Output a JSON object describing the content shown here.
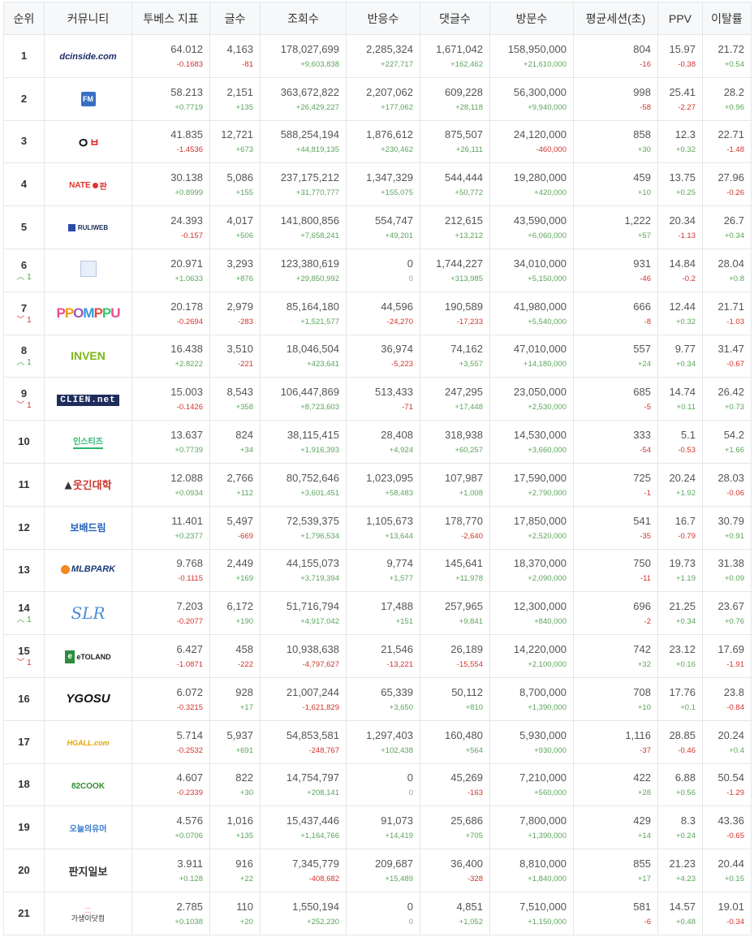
{
  "headers": [
    "순위",
    "커뮤니티",
    "투베스 지표",
    "글수",
    "조회수",
    "반응수",
    "댓글수",
    "방문수",
    "평균세션(초)",
    "PPV",
    "이탈률"
  ],
  "rows": [
    {
      "rank": "1",
      "change": "",
      "dir": "",
      "logo": "dcinside.com",
      "logo_icon": "dcinside-logo-icon",
      "cells": [
        [
          "64.012",
          "-0.1683"
        ],
        [
          "4,163",
          "-81"
        ],
        [
          "178,027,699",
          "+9,603,838"
        ],
        [
          "2,285,324",
          "+227,717"
        ],
        [
          "1,671,042",
          "+162,462"
        ],
        [
          "158,950,000",
          "+21,610,000"
        ],
        [
          "804",
          "-16"
        ],
        [
          "15.97",
          "-0.38"
        ],
        [
          "21.72",
          "+0.54"
        ]
      ]
    },
    {
      "rank": "2",
      "change": "",
      "dir": "",
      "logo": "FM",
      "logo_icon": "fmkorea-logo-icon",
      "cells": [
        [
          "58.213",
          "+0.7719"
        ],
        [
          "2,151",
          "+135"
        ],
        [
          "363,672,822",
          "+26,429,227"
        ],
        [
          "2,207,062",
          "+177,062"
        ],
        [
          "609,228",
          "+28,118"
        ],
        [
          "56,300,000",
          "+9,940,000"
        ],
        [
          "998",
          "-58"
        ],
        [
          "25.41",
          "-2.27"
        ],
        [
          "28.2",
          "+0.96"
        ]
      ]
    },
    {
      "rank": "3",
      "change": "",
      "dir": "",
      "logo": "ㅇㅂ",
      "logo_icon": "ilbe-logo-icon",
      "cells": [
        [
          "41.835",
          "-1.4536"
        ],
        [
          "12,721",
          "+673"
        ],
        [
          "588,254,194",
          "+44,819,135"
        ],
        [
          "1,876,612",
          "+230,462"
        ],
        [
          "875,507",
          "+26,111"
        ],
        [
          "24,120,000",
          "-460,000"
        ],
        [
          "858",
          "+30"
        ],
        [
          "12.3",
          "+0.32"
        ],
        [
          "22.71",
          "-1.48"
        ]
      ]
    },
    {
      "rank": "4",
      "change": "",
      "dir": "",
      "logo": "NATE 판",
      "logo_icon": "nate-pann-logo-icon",
      "cells": [
        [
          "30.138",
          "+0.8999"
        ],
        [
          "5,086",
          "+155"
        ],
        [
          "237,175,212",
          "+31,770,777"
        ],
        [
          "1,347,329",
          "+155,075"
        ],
        [
          "544,444",
          "+50,772"
        ],
        [
          "19,280,000",
          "+420,000"
        ],
        [
          "459",
          "+10"
        ],
        [
          "13.75",
          "+0.25"
        ],
        [
          "27.96",
          "-0.26"
        ]
      ]
    },
    {
      "rank": "5",
      "change": "",
      "dir": "",
      "logo": "RULIWEB",
      "logo_icon": "ruliweb-logo-icon",
      "cells": [
        [
          "24.393",
          "-0.157"
        ],
        [
          "4,017",
          "+506"
        ],
        [
          "141,800,856",
          "+7,658,241"
        ],
        [
          "554,747",
          "+49,201"
        ],
        [
          "212,615",
          "+13,212"
        ],
        [
          "43,590,000",
          "+6,060,000"
        ],
        [
          "1,222",
          "+57"
        ],
        [
          "20.34",
          "-1.13"
        ],
        [
          "26.7",
          "+0.34"
        ]
      ]
    },
    {
      "rank": "6",
      "change": "1",
      "dir": "up",
      "logo": "",
      "logo_icon": "theqoo-logo-icon",
      "cells": [
        [
          "20.971",
          "+1.0633"
        ],
        [
          "3,293",
          "+876"
        ],
        [
          "123,380,619",
          "+29,850,992"
        ],
        [
          "0",
          "0"
        ],
        [
          "1,744,227",
          "+313,985"
        ],
        [
          "34,010,000",
          "+5,150,000"
        ],
        [
          "931",
          "-46"
        ],
        [
          "14.84",
          "-0.2"
        ],
        [
          "28.04",
          "+0.8"
        ]
      ]
    },
    {
      "rank": "7",
      "change": "1",
      "dir": "down",
      "logo": "PPOMPPU",
      "logo_icon": "ppomppu-logo-icon",
      "cells": [
        [
          "20.178",
          "-0.2694"
        ],
        [
          "2,979",
          "-283"
        ],
        [
          "85,164,180",
          "+1,521,577"
        ],
        [
          "44,596",
          "-24,270"
        ],
        [
          "190,589",
          "-17,233"
        ],
        [
          "41,980,000",
          "+5,540,000"
        ],
        [
          "666",
          "-8"
        ],
        [
          "12.44",
          "+0.32"
        ],
        [
          "21.71",
          "-1.03"
        ]
      ]
    },
    {
      "rank": "8",
      "change": "1",
      "dir": "up",
      "logo": "INVEN",
      "logo_icon": "inven-logo-icon",
      "cells": [
        [
          "16.438",
          "+2.8222"
        ],
        [
          "3,510",
          "-221"
        ],
        [
          "18,046,504",
          "+423,641"
        ],
        [
          "36,974",
          "-5,223"
        ],
        [
          "74,162",
          "+3,557"
        ],
        [
          "47,010,000",
          "+14,180,000"
        ],
        [
          "557",
          "+24"
        ],
        [
          "9.77",
          "+0.34"
        ],
        [
          "31.47",
          "-0.67"
        ]
      ]
    },
    {
      "rank": "9",
      "change": "1",
      "dir": "down",
      "logo": "CLIEN.net",
      "logo_icon": "clien-logo-icon",
      "cells": [
        [
          "15.003",
          "-0.1426"
        ],
        [
          "8,543",
          "+358"
        ],
        [
          "106,447,869",
          "+8,723,603"
        ],
        [
          "513,433",
          "-71"
        ],
        [
          "247,295",
          "+17,448"
        ],
        [
          "23,050,000",
          "+2,530,000"
        ],
        [
          "685",
          "-5"
        ],
        [
          "14.74",
          "+0.11"
        ],
        [
          "26.42",
          "+0.73"
        ]
      ]
    },
    {
      "rank": "10",
      "change": "",
      "dir": "",
      "logo": "인스티즈",
      "logo_icon": "instiz-logo-icon",
      "cells": [
        [
          "13.637",
          "+0.7739"
        ],
        [
          "824",
          "+34"
        ],
        [
          "38,115,415",
          "+1,916,393"
        ],
        [
          "28,408",
          "+4,924"
        ],
        [
          "318,938",
          "+60,257"
        ],
        [
          "14,530,000",
          "+3,660,000"
        ],
        [
          "333",
          "-54"
        ],
        [
          "5.1",
          "-0.53"
        ],
        [
          "54.2",
          "+1.66"
        ]
      ]
    },
    {
      "rank": "11",
      "change": "",
      "dir": "",
      "logo": "웃긴대학",
      "logo_icon": "humoruniv-logo-icon",
      "cells": [
        [
          "12.088",
          "+0.0934"
        ],
        [
          "2,766",
          "+112"
        ],
        [
          "80,752,646",
          "+3,601,451"
        ],
        [
          "1,023,095",
          "+58,483"
        ],
        [
          "107,987",
          "+1,008"
        ],
        [
          "17,590,000",
          "+2,790,000"
        ],
        [
          "725",
          "-1"
        ],
        [
          "20.24",
          "+1.92"
        ],
        [
          "28.03",
          "-0.06"
        ]
      ]
    },
    {
      "rank": "12",
      "change": "",
      "dir": "",
      "logo": "보배드림",
      "logo_icon": "bobaedream-logo-icon",
      "cells": [
        [
          "11.401",
          "+0.2377"
        ],
        [
          "5,497",
          "-669"
        ],
        [
          "72,539,375",
          "+1,796,534"
        ],
        [
          "1,105,673",
          "+13,644"
        ],
        [
          "178,770",
          "-2,640"
        ],
        [
          "17,850,000",
          "+2,520,000"
        ],
        [
          "541",
          "-35"
        ],
        [
          "16.7",
          "-0.79"
        ],
        [
          "30.79",
          "+0.91"
        ]
      ]
    },
    {
      "rank": "13",
      "change": "",
      "dir": "",
      "logo": "MLBPARK",
      "logo_icon": "mlbpark-logo-icon",
      "cells": [
        [
          "9.768",
          "-0.1115"
        ],
        [
          "2,449",
          "+169"
        ],
        [
          "44,155,073",
          "+3,719,394"
        ],
        [
          "9,774",
          "+1,577"
        ],
        [
          "145,641",
          "+11,978"
        ],
        [
          "18,370,000",
          "+2,090,000"
        ],
        [
          "750",
          "-11"
        ],
        [
          "19.73",
          "+1.19"
        ],
        [
          "31.38",
          "+0.09"
        ]
      ]
    },
    {
      "rank": "14",
      "change": "1",
      "dir": "up",
      "logo": "SLR",
      "logo_icon": "slr-logo-icon",
      "cells": [
        [
          "7.203",
          "-0.2077"
        ],
        [
          "6,172",
          "+190"
        ],
        [
          "51,716,794",
          "+4,917,042"
        ],
        [
          "17,488",
          "+151"
        ],
        [
          "257,965",
          "+9,841"
        ],
        [
          "12,300,000",
          "+840,000"
        ],
        [
          "696",
          "-2"
        ],
        [
          "21.25",
          "+0.34"
        ],
        [
          "23.67",
          "+0.76"
        ]
      ]
    },
    {
      "rank": "15",
      "change": "1",
      "dir": "down",
      "logo": "eTOLAND",
      "logo_icon": "etoland-logo-icon",
      "cells": [
        [
          "6.427",
          "-1.0871"
        ],
        [
          "458",
          "-222"
        ],
        [
          "10,938,638",
          "-4,797,627"
        ],
        [
          "21,546",
          "-13,221"
        ],
        [
          "26,189",
          "-15,554"
        ],
        [
          "14,220,000",
          "+2,100,000"
        ],
        [
          "742",
          "+32"
        ],
        [
          "23.12",
          "+0.16"
        ],
        [
          "17.69",
          "-1.91"
        ]
      ]
    },
    {
      "rank": "16",
      "change": "",
      "dir": "",
      "logo": "YGOSU",
      "logo_icon": "ygosu-logo-icon",
      "cells": [
        [
          "6.072",
          "-0.3215"
        ],
        [
          "928",
          "+17"
        ],
        [
          "21,007,244",
          "-1,621,829"
        ],
        [
          "65,339",
          "+3,650"
        ],
        [
          "50,112",
          "+810"
        ],
        [
          "8,700,000",
          "+1,390,000"
        ],
        [
          "708",
          "+10"
        ],
        [
          "17.76",
          "+0.1"
        ],
        [
          "23.8",
          "-0.84"
        ]
      ]
    },
    {
      "rank": "17",
      "change": "",
      "dir": "",
      "logo": "HGALL.com",
      "logo_icon": "hgall-logo-icon",
      "cells": [
        [
          "5.714",
          "-0.2532"
        ],
        [
          "5,937",
          "+691"
        ],
        [
          "54,853,581",
          "-248,767"
        ],
        [
          "1,297,403",
          "+102,438"
        ],
        [
          "160,480",
          "+564"
        ],
        [
          "5,930,000",
          "+930,000"
        ],
        [
          "1,116",
          "-37"
        ],
        [
          "28.85",
          "-0.46"
        ],
        [
          "20.24",
          "+0.4"
        ]
      ]
    },
    {
      "rank": "18",
      "change": "",
      "dir": "",
      "logo": "82COOK",
      "logo_icon": "82cook-logo-icon",
      "cells": [
        [
          "4.607",
          "-0.2339"
        ],
        [
          "822",
          "+30"
        ],
        [
          "14,754,797",
          "+208,141"
        ],
        [
          "0",
          "0"
        ],
        [
          "45,269",
          "-163"
        ],
        [
          "7,210,000",
          "+560,000"
        ],
        [
          "422",
          "+28"
        ],
        [
          "6.88",
          "+0.56"
        ],
        [
          "50.54",
          "-1.29"
        ]
      ]
    },
    {
      "rank": "19",
      "change": "",
      "dir": "",
      "logo": "오늘의유머",
      "logo_icon": "todayhumor-logo-icon",
      "cells": [
        [
          "4.576",
          "+0.0706"
        ],
        [
          "1,016",
          "+135"
        ],
        [
          "15,437,446",
          "+1,164,766"
        ],
        [
          "91,073",
          "+14,419"
        ],
        [
          "25,686",
          "+705"
        ],
        [
          "7,800,000",
          "+1,390,000"
        ],
        [
          "429",
          "+14"
        ],
        [
          "8.3",
          "+0.24"
        ],
        [
          "43.36",
          "-0.65"
        ]
      ]
    },
    {
      "rank": "20",
      "change": "",
      "dir": "",
      "logo": "판지일보",
      "logo_icon": "pannzi-logo-icon",
      "cells": [
        [
          "3.911",
          "+0.128"
        ],
        [
          "916",
          "+22"
        ],
        [
          "7,345,779",
          "-408,682"
        ],
        [
          "209,687",
          "+15,489"
        ],
        [
          "36,400",
          "-328"
        ],
        [
          "8,810,000",
          "+1,840,000"
        ],
        [
          "855",
          "+17"
        ],
        [
          "21.23",
          "+4.23"
        ],
        [
          "20.44",
          "+0.15"
        ]
      ]
    },
    {
      "rank": "21",
      "change": "",
      "dir": "",
      "logo": "가생이닷컴",
      "logo_icon": "gasengi-logo-icon",
      "cells": [
        [
          "2.785",
          "+0.1038"
        ],
        [
          "110",
          "+20"
        ],
        [
          "1,550,194",
          "+252,230"
        ],
        [
          "0",
          "0"
        ],
        [
          "4,851",
          "+1,052"
        ],
        [
          "7,510,000",
          "+1,150,000"
        ],
        [
          "581",
          "-6"
        ],
        [
          "14.57",
          "+0.48"
        ],
        [
          "19.01",
          "-0.34"
        ]
      ]
    }
  ]
}
